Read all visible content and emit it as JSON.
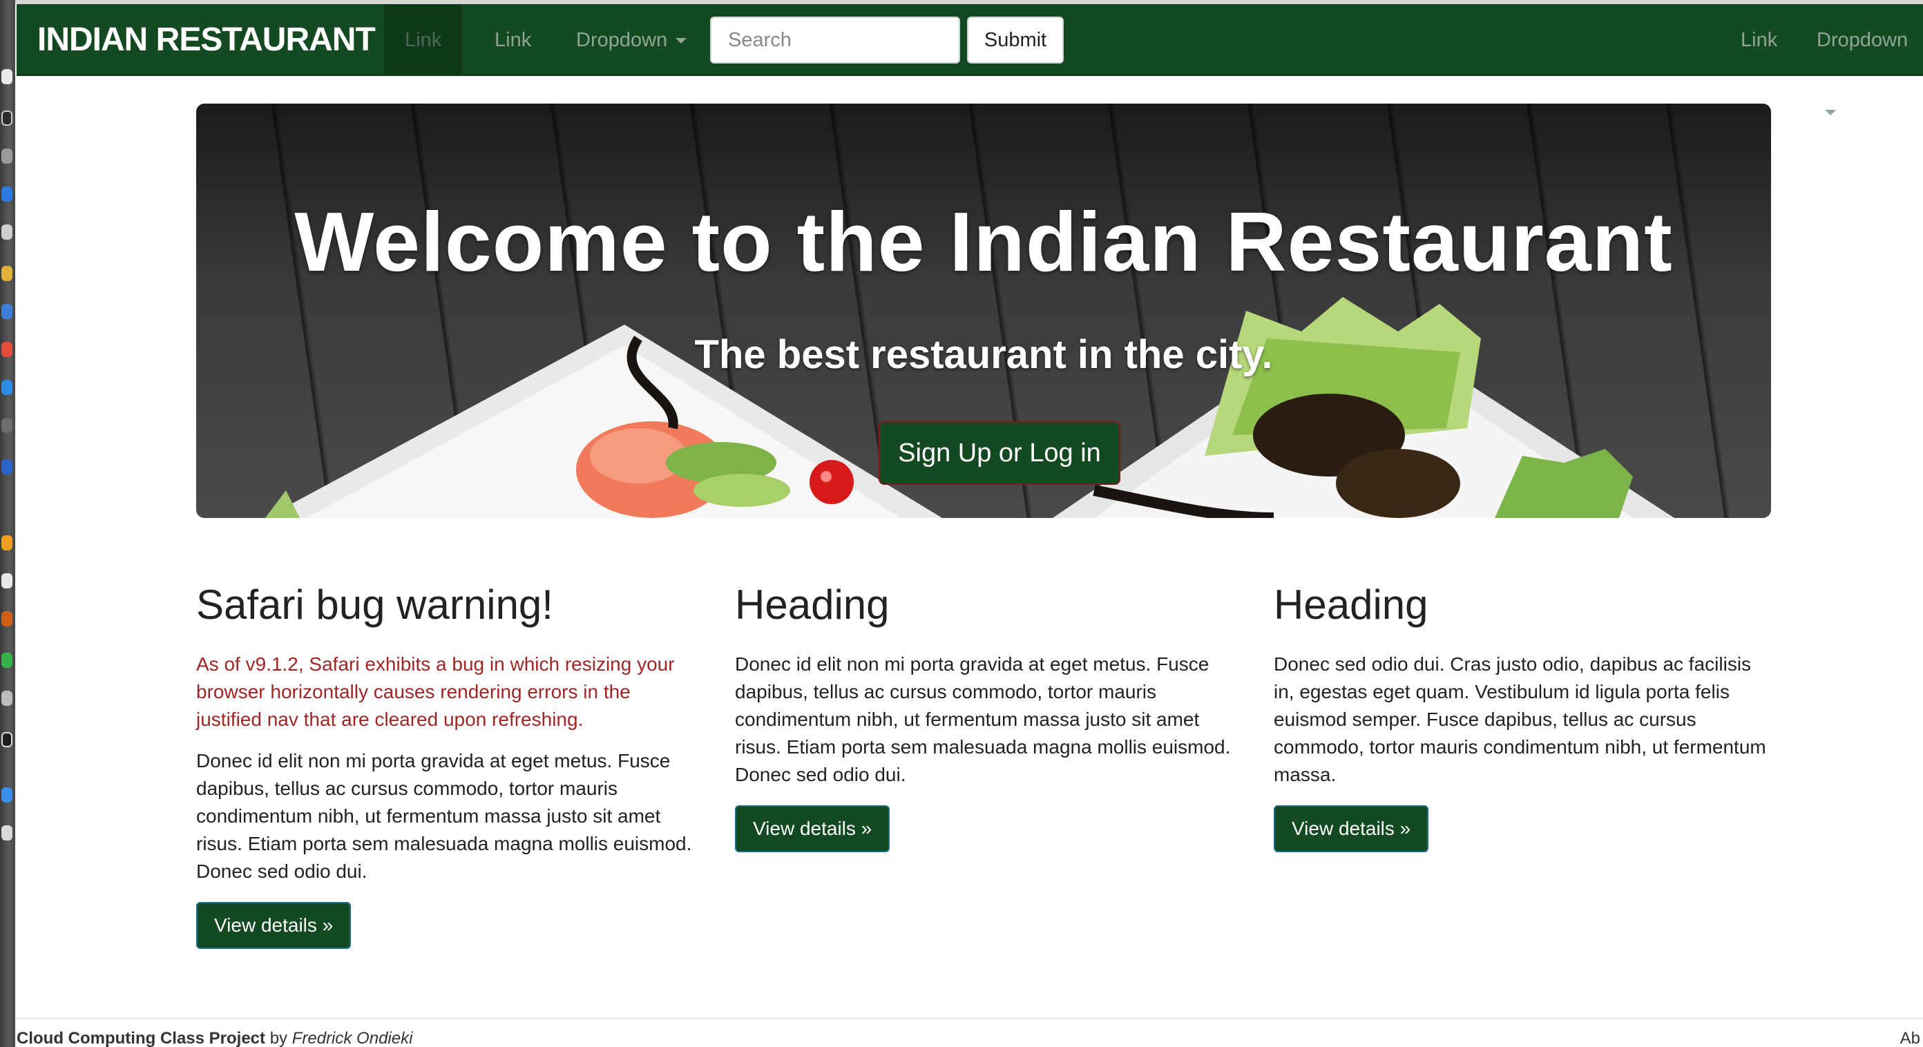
{
  "navbar": {
    "brand": "INDIAN RESTAURANT",
    "left_links": [
      {
        "label": "Link",
        "active": true
      },
      {
        "label": "Link",
        "active": false
      },
      {
        "label": "Dropdown",
        "dropdown": true
      }
    ],
    "search": {
      "placeholder": "Search",
      "value": ""
    },
    "submit_label": "Submit",
    "right_links": [
      {
        "label": "Link"
      },
      {
        "label": "Dropdown",
        "dropdown": true
      }
    ]
  },
  "hero": {
    "title": "Welcome to the Indian Restaurant",
    "subtitle": "The best restaurant in the city.",
    "cta_label": "Sign Up or Log in"
  },
  "columns": [
    {
      "heading": "Safari bug warning!",
      "warning": "As of v9.1.2, Safari exhibits a bug in which resizing your browser horizontally causes rendering errors in the justified nav that are cleared upon refreshing.",
      "body": "Donec id elit non mi porta gravida at eget metus. Fusce dapibus, tellus ac cursus commodo, tortor mauris condimentum nibh, ut fermentum massa justo sit amet risus. Etiam porta sem malesuada magna mollis euismod. Donec sed odio dui.",
      "button": "View details »"
    },
    {
      "heading": "Heading",
      "body": "Donec id elit non mi porta gravida at eget metus. Fusce dapibus, tellus ac cursus commodo, tortor mauris condimentum nibh, ut fermentum massa justo sit amet risus. Etiam porta sem malesuada magna mollis euismod. Donec sed odio dui.",
      "button": "View details »"
    },
    {
      "heading": "Heading",
      "body": "Donec sed odio dui. Cras justo odio, dapibus ac facilisis in, egestas eget quam. Vestibulum id ligula porta felis euismod semper. Fusce dapibus, tellus ac cursus commodo, tortor mauris condimentum nibh, ut fermentum massa.",
      "button": "View details »"
    }
  ],
  "footer": {
    "project": "Cloud Computing Class Project",
    "by": " by ",
    "author": "Fredrick Ondieki",
    "right": "Ab"
  },
  "colors": {
    "navbar_bg": "#144a21",
    "warning_text": "#a02626",
    "button_bg": "#144a21"
  }
}
